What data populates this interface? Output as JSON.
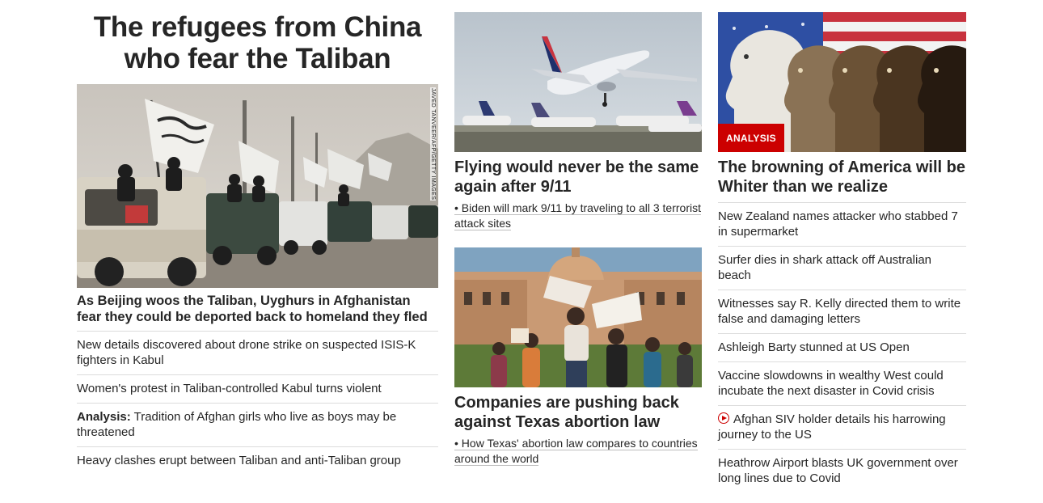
{
  "left": {
    "hero_title": "The refugees from China who fear the Taliban",
    "image_credit": "JAVED TANVEER/AFP/GETTY IMAGES",
    "lead_headline": "As Beijing woos the Taliban, Uyghurs in Afghanistan fear they could be deported back to homeland they fled",
    "items": [
      {
        "prefix": "",
        "text": "New details discovered about drone strike on suspected ISIS-K fighters in Kabul"
      },
      {
        "prefix": "",
        "text": "Women's protest in Taliban-controlled Kabul turns violent"
      },
      {
        "prefix": "Analysis:",
        "text": " Tradition of Afghan girls who live as boys may be threatened"
      },
      {
        "prefix": "",
        "text": "Heavy clashes erupt between Taliban and anti-Taliban group"
      }
    ]
  },
  "middle": {
    "story1": {
      "headline": "Flying would never be the same again after 9/11",
      "sublink": "Biden will mark 9/11 by traveling to all 3 terrorist attack sites"
    },
    "story2": {
      "headline": "Companies are pushing back against Texas abortion law",
      "sublink": "How Texas' abortion law compares to countries around the world"
    },
    "bullet": "•"
  },
  "right": {
    "badge": "ANALYSIS",
    "headline": "The browning of America will be Whiter than we realize",
    "items": [
      {
        "text": "New Zealand names attacker who stabbed 7 in supermarket",
        "video": false
      },
      {
        "text": "Surfer dies in shark attack off Australian beach",
        "video": false
      },
      {
        "text": "Witnesses say R. Kelly directed them to write false and damaging letters",
        "video": false
      },
      {
        "text": "Ashleigh Barty stunned at US Open",
        "video": false
      },
      {
        "text": "Vaccine slowdowns in wealthy West could incubate the next disaster in Covid crisis",
        "video": false
      },
      {
        "text": "Afghan SIV holder details his harrowing journey to the US",
        "video": true
      },
      {
        "text": "Heathrow Airport blasts UK government over long lines due to Covid",
        "video": false
      }
    ]
  },
  "colors": {
    "text": "#262626",
    "divider": "#dcdcdc",
    "accent_red": "#cc0000"
  }
}
